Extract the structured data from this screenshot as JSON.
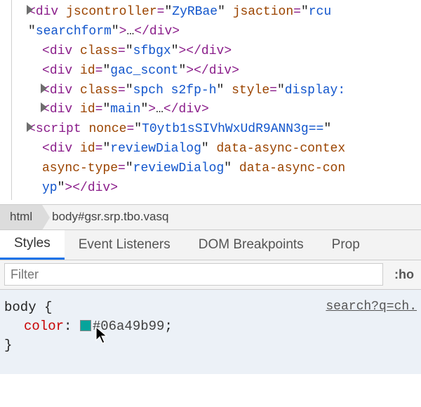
{
  "dom": {
    "l0": {
      "tag": "div",
      "attrs": [
        {
          "name": "jscontroller",
          "val": "ZyRBae"
        },
        {
          "name": "jsaction",
          "val": "rcu"
        }
      ],
      "contAttr": {
        "val": "searchform"
      },
      "ellipsis": "…"
    },
    "l1": {
      "tag": "div",
      "attr": {
        "name": "class",
        "val": "sfbgx"
      }
    },
    "l2": {
      "tag": "div",
      "attr": {
        "name": "id",
        "val": "gac_scont"
      }
    },
    "l3": {
      "tag": "div",
      "attrs": [
        {
          "name": "class",
          "val": "spch s2fp-h"
        },
        {
          "name": "style",
          "val": "display:"
        }
      ],
      "ellipsis": "…"
    },
    "l4": {
      "tag": "div",
      "attr": {
        "name": "id",
        "val": "main"
      },
      "ellipsis": "…"
    },
    "l5": {
      "tag": "script",
      "attr": {
        "name": "nonce",
        "val": "T0ytb1sSIVhWxUdR9ANN3g=="
      }
    },
    "l6": {
      "tag": "div",
      "a1": {
        "name": "id",
        "val": "reviewDialog"
      },
      "a2name": "data-async-contex",
      "a3": {
        "name": "async-type",
        "val": "reviewDialog"
      },
      "a4name": "data-async-con",
      "a5val": "yp"
    }
  },
  "breadcrumb": {
    "c0": "html",
    "c1": "body#gsr.srp.tbo.vasq"
  },
  "tabs": {
    "t0": "Styles",
    "t1": "Event Listeners",
    "t2": "DOM Breakpoints",
    "t3": "Prop"
  },
  "filter": {
    "placeholder": "Filter",
    "hov": ":ho"
  },
  "rule": {
    "selector": "body",
    "open": "{",
    "close": "}",
    "prop": "color",
    "colon": ":",
    "value": "#06a49b99",
    "semicolon": ";",
    "swatch_color": "#06a49b",
    "source": "search?q=ch."
  }
}
